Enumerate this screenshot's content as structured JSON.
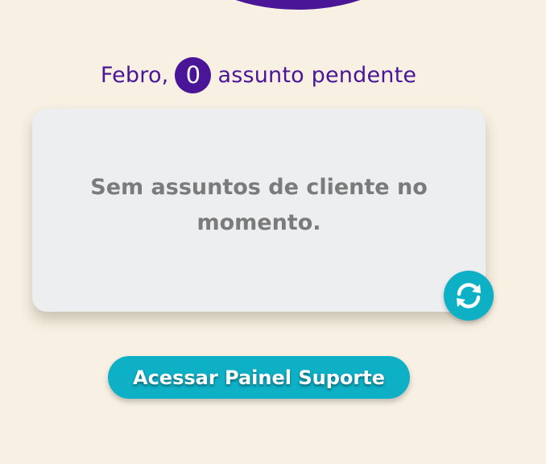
{
  "greeting": {
    "name": "Febro,",
    "pending_count": "0",
    "suffix": "assunto pendente"
  },
  "card": {
    "empty_message": "Sem assuntos de cliente no momento."
  },
  "actions": {
    "refresh_icon": "refresh-icon",
    "support_panel_label": "Acessar Painel Suporte"
  },
  "colors": {
    "background": "#f7f0e3",
    "brand_purple": "#4a1596",
    "accent_teal": "#0eb0c6",
    "card": "#eceef0"
  }
}
